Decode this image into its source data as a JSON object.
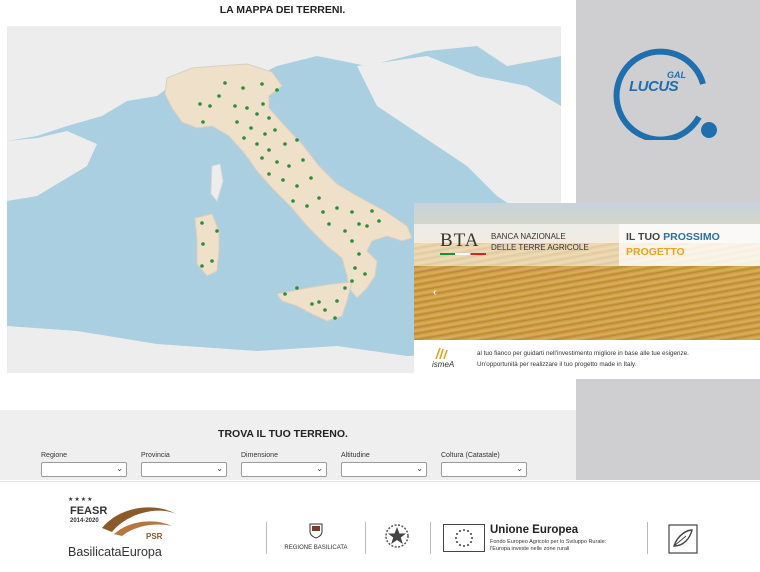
{
  "map": {
    "title": "LA MAPPA DEI TERRENI."
  },
  "logo": {
    "gal": "GAL",
    "lucus": "LUCUS",
    "brand_color": "#1f6fae"
  },
  "banner": {
    "bta": "BTA",
    "bta_line1": "BANCA NAZIONALE",
    "bta_line2": "DELLE TERRE AGRICOLE",
    "headline_part1": "IL TUO ",
    "headline_part2": "PROSSIMO",
    "headline_line2": "PROGETTO",
    "ismea": "ismeA",
    "tagline1": "al tuo fianco per guidarti nell'investimento migliore in base alle tue esigenze.",
    "tagline2": "Un'opportunità per realizzare il tuo progetto made in Italy.",
    "prev_icon": "chevron-left-icon"
  },
  "search": {
    "title": "TROVA IL TUO TERRENO.",
    "filters": [
      {
        "label": "Regione",
        "value": ""
      },
      {
        "label": "Provincia",
        "value": ""
      },
      {
        "label": "Dimensione",
        "value": ""
      },
      {
        "label": "Altitudine",
        "value": ""
      },
      {
        "label": "Coltura (Catastale)",
        "value": ""
      }
    ]
  },
  "footer": {
    "feasr": "FEASR",
    "feasr_years": "2014-2020",
    "psr": "PSR",
    "basilicata": "BasilicataEuropa",
    "regione": "REGIONE BASILICATA",
    "ue_title": "Unione Europea",
    "ue_line1": "Fondo Europeo Agricolo per lo Sviluppo Rurale:",
    "ue_line2": "l'Europa investe nelle zone rurali"
  }
}
